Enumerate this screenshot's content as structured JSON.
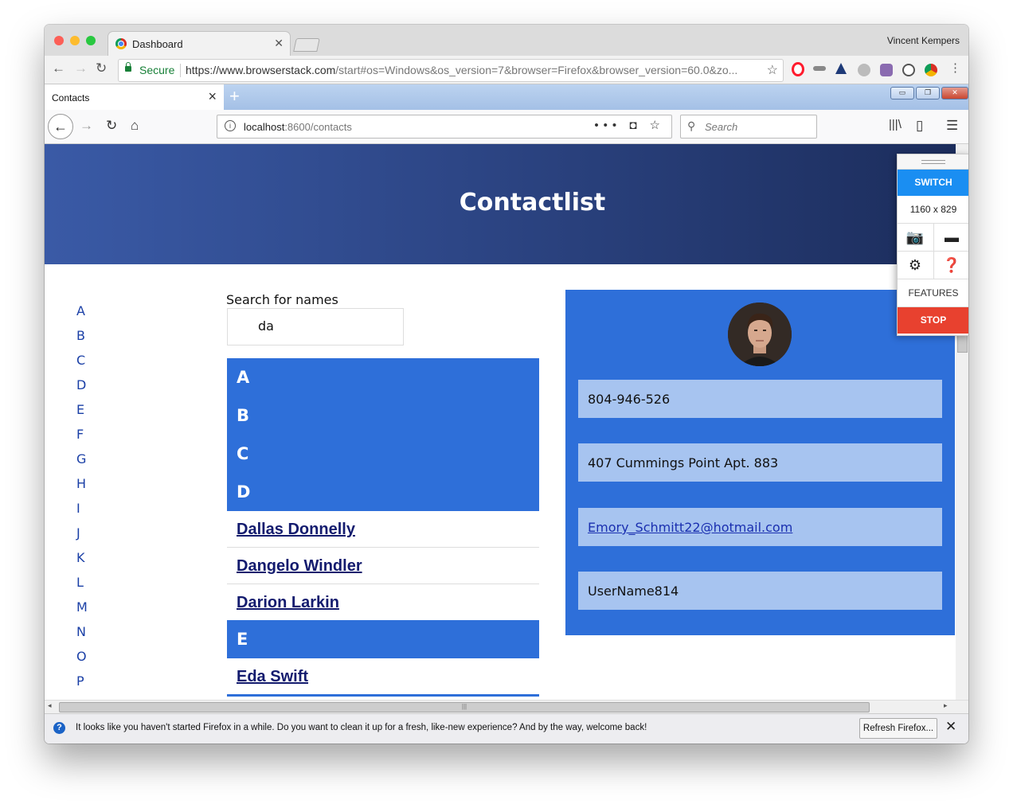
{
  "chrome": {
    "tab_title": "Dashboard",
    "profile_name": "Vincent Kempers",
    "secure_label": "Secure",
    "url_host": "https://www.browserstack.com",
    "url_rest": "/start#os=Windows&os_version=7&browser=Firefox&browser_version=60.0&zo..."
  },
  "firefox": {
    "tab_title": "Contacts",
    "url_host": "localhost",
    "url_rest": ":8600/contacts",
    "search_placeholder": "Search"
  },
  "page": {
    "title": "Contactlist",
    "alphabet": [
      "A",
      "B",
      "C",
      "D",
      "E",
      "F",
      "G",
      "H",
      "I",
      "J",
      "K",
      "L",
      "M",
      "N",
      "O",
      "P"
    ],
    "search_label": "Search for names",
    "search_value": "da",
    "groups_collapsed": [
      "A",
      "B",
      "C",
      "D"
    ],
    "contacts_d": [
      "Dallas Donnelly",
      "Dangelo Windler",
      "Darion Larkin"
    ],
    "group_e": "E",
    "contacts_e": [
      "Eda Swift"
    ]
  },
  "detail": {
    "phone": "804-946-526",
    "address": "407 Cummings Point Apt. 883",
    "email": "Emory_Schmitt22@hotmail.com",
    "username": "UserName814"
  },
  "browserstack": {
    "switch_label": "SWITCH",
    "resolution": "1160 x 829",
    "features_label": "FEATURES",
    "stop_label": "STOP"
  },
  "notification": {
    "message": "It looks like you haven't started Firefox in a while. Do you want to clean it up for a fresh, like-new experience? And by the way, welcome back!",
    "button": "Refresh Firefox..."
  },
  "colors": {
    "accent": "#2e6fd9",
    "field": "#a7c4f0",
    "link": "#131b6e",
    "stop": "#e8412f",
    "switch": "#1a8ef2"
  }
}
